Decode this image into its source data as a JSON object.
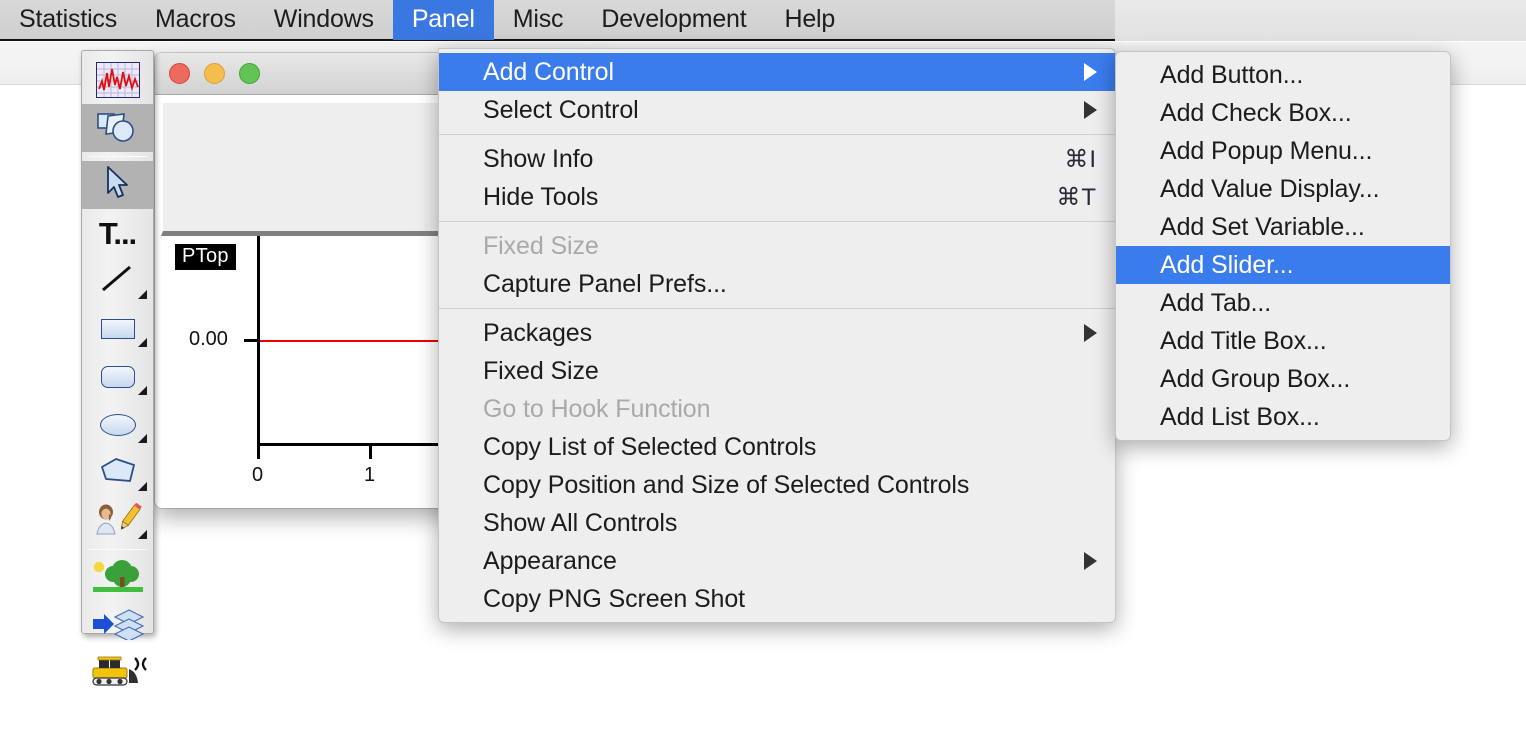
{
  "menubar": {
    "items": [
      {
        "label": "Statistics",
        "active": false
      },
      {
        "label": "Macros",
        "active": false
      },
      {
        "label": "Windows",
        "active": false
      },
      {
        "label": "Panel",
        "active": true
      },
      {
        "label": "Misc",
        "active": false
      },
      {
        "label": "Development",
        "active": false
      },
      {
        "label": "Help",
        "active": false
      }
    ]
  },
  "panel_menu": {
    "title": "Panel",
    "items": [
      {
        "label": "Add Control",
        "submenu": true,
        "highlighted": true,
        "disabled": false,
        "shortcut": ""
      },
      {
        "label": "Select Control",
        "submenu": true,
        "highlighted": false,
        "disabled": false,
        "shortcut": ""
      },
      {
        "separator": true
      },
      {
        "label": "Show Info",
        "submenu": false,
        "highlighted": false,
        "disabled": false,
        "shortcut": "⌘I"
      },
      {
        "label": "Hide Tools",
        "submenu": false,
        "highlighted": false,
        "disabled": false,
        "shortcut": "⌘T"
      },
      {
        "separator": true
      },
      {
        "label": "Fixed Size",
        "submenu": false,
        "highlighted": false,
        "disabled": true,
        "shortcut": ""
      },
      {
        "label": "Capture Panel Prefs...",
        "submenu": false,
        "highlighted": false,
        "disabled": false,
        "shortcut": ""
      },
      {
        "separator": true
      },
      {
        "label": "Packages",
        "submenu": true,
        "highlighted": false,
        "disabled": false,
        "shortcut": ""
      },
      {
        "label": "Fixed Size",
        "submenu": false,
        "highlighted": false,
        "disabled": false,
        "shortcut": ""
      },
      {
        "label": "Go to Hook Function",
        "submenu": false,
        "highlighted": false,
        "disabled": true,
        "shortcut": ""
      },
      {
        "label": "Copy List of Selected Controls",
        "submenu": false,
        "highlighted": false,
        "disabled": false,
        "shortcut": ""
      },
      {
        "label": "Copy Position and Size of Selected Controls",
        "submenu": false,
        "highlighted": false,
        "disabled": false,
        "shortcut": ""
      },
      {
        "label": "Show All Controls",
        "submenu": false,
        "highlighted": false,
        "disabled": false,
        "shortcut": ""
      },
      {
        "label": "Appearance",
        "submenu": true,
        "highlighted": false,
        "disabled": false,
        "shortcut": ""
      },
      {
        "label": "Copy PNG Screen Shot",
        "submenu": false,
        "highlighted": false,
        "disabled": false,
        "shortcut": ""
      }
    ]
  },
  "add_control_submenu": {
    "items": [
      {
        "label": "Add Button...",
        "highlighted": false
      },
      {
        "label": "Add Check Box...",
        "highlighted": false
      },
      {
        "label": "Add Popup Menu...",
        "highlighted": false
      },
      {
        "label": "Add Value Display...",
        "highlighted": false
      },
      {
        "label": "Add Set Variable...",
        "highlighted": false
      },
      {
        "label": "Add Slider...",
        "highlighted": true
      },
      {
        "label": "Add Tab...",
        "highlighted": false
      },
      {
        "label": "Add Title Box...",
        "highlighted": false
      },
      {
        "label": "Add Group Box...",
        "highlighted": false
      },
      {
        "label": "Add List Box...",
        "highlighted": false
      }
    ]
  },
  "tool_palette": {
    "tools": [
      {
        "name": "graph-waveform-tool",
        "selected": false
      },
      {
        "name": "drawing-shapes-tool",
        "selected": true
      },
      {
        "name": "arrow-select-tool",
        "selected": true
      },
      {
        "name": "text-tool",
        "label": "T...",
        "selected": false
      },
      {
        "name": "line-tool",
        "selected": false
      },
      {
        "name": "rectangle-tool",
        "selected": false
      },
      {
        "name": "rounded-rectangle-tool",
        "selected": false
      },
      {
        "name": "oval-tool",
        "selected": false
      },
      {
        "name": "polygon-tool",
        "selected": false
      },
      {
        "name": "drawing-edit-tool",
        "selected": false
      },
      {
        "name": "picture-tool",
        "selected": false
      },
      {
        "name": "send-to-layer-tool",
        "selected": false
      },
      {
        "name": "bulldozer-tool",
        "selected": false
      }
    ]
  },
  "panel_window": {
    "title": "",
    "traffic_lights": [
      "close",
      "minimize",
      "zoom"
    ],
    "graph": {
      "trace_label": "PTop",
      "y_ticks": [
        "0.00"
      ],
      "x_ticks": [
        "0",
        "1"
      ],
      "trace_color": "#ee0000"
    }
  },
  "colors": {
    "highlight": "#3b7ced",
    "menubar_active": "#3b77e0",
    "menu_bg": "#eeeeee",
    "disabled_text": "#a9a9a9"
  },
  "chart_data": {
    "type": "line",
    "title": "PTop",
    "xlabel": "",
    "ylabel": "",
    "x": [
      0,
      1
    ],
    "series": [
      {
        "name": "PTop",
        "values": [
          0.0,
          0.0
        ],
        "color": "#ee0000"
      }
    ],
    "y_tick_labels": [
      "0.00"
    ],
    "x_tick_labels": [
      "0",
      "1"
    ],
    "grid": false,
    "legend": "none"
  }
}
